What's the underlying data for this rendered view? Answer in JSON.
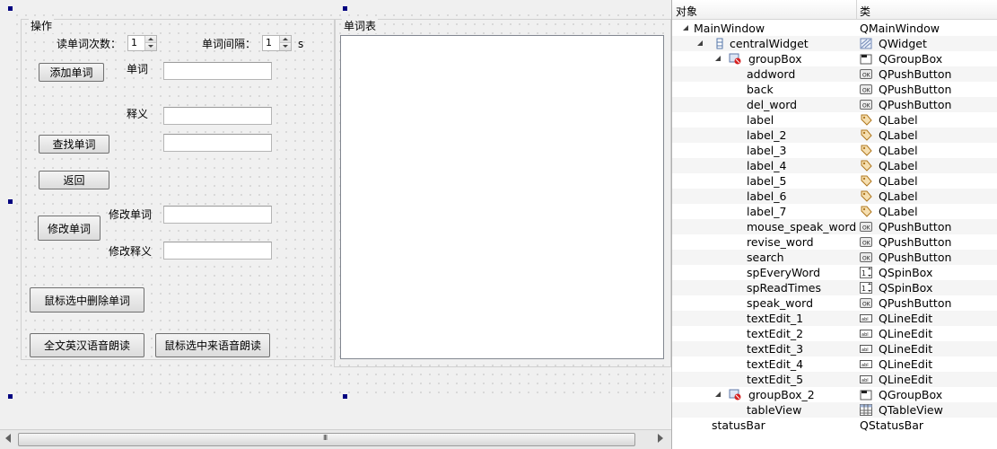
{
  "form": {
    "groupbox_ops_title": "操作",
    "groupbox_table_title": "单词表",
    "read_times_label": "读单词次数：",
    "read_times_value": "1",
    "interval_label": "单词间隔：",
    "interval_value": "1",
    "interval_unit": "s",
    "word_label": "单词",
    "meaning_label": "释义",
    "revise_word_label": "修改单词",
    "revise_meaning_label": "修改释义",
    "buttons": {
      "add_word": "添加单词",
      "search": "查找单词",
      "back": "返回",
      "revise": "修改单词",
      "delete_selected": "鼠标选中删除单词",
      "speak_all": "全文英汉语音朗读",
      "speak_selected": "鼠标选中来语音朗读"
    },
    "scrollbar_grip": "III"
  },
  "inspector": {
    "col_object": "对象",
    "col_class": "类",
    "rows": [
      {
        "object": "MainWindow",
        "class": "QMainWindow",
        "icon": "none",
        "class_icon": "none",
        "level": 0,
        "expander": true
      },
      {
        "object": "centralWidget",
        "class": "QWidget",
        "icon": "grid-layout-icon",
        "class_icon": "widget-icon",
        "level": 1,
        "expander": true
      },
      {
        "object": "groupBox",
        "class": "QGroupBox",
        "icon": "broken-layout-icon",
        "class_icon": "groupbox-icon",
        "level": 2,
        "expander": true
      },
      {
        "object": "addword",
        "class": "QPushButton",
        "icon": "none",
        "class_icon": "pushbutton-icon",
        "level": 3,
        "expander": false
      },
      {
        "object": "back",
        "class": "QPushButton",
        "icon": "none",
        "class_icon": "pushbutton-icon",
        "level": 3,
        "expander": false
      },
      {
        "object": "del_word",
        "class": "QPushButton",
        "icon": "none",
        "class_icon": "pushbutton-icon",
        "level": 3,
        "expander": false
      },
      {
        "object": "label",
        "class": "QLabel",
        "icon": "none",
        "class_icon": "label-icon",
        "level": 3,
        "expander": false
      },
      {
        "object": "label_2",
        "class": "QLabel",
        "icon": "none",
        "class_icon": "label-icon",
        "level": 3,
        "expander": false
      },
      {
        "object": "label_3",
        "class": "QLabel",
        "icon": "none",
        "class_icon": "label-icon",
        "level": 3,
        "expander": false
      },
      {
        "object": "label_4",
        "class": "QLabel",
        "icon": "none",
        "class_icon": "label-icon",
        "level": 3,
        "expander": false
      },
      {
        "object": "label_5",
        "class": "QLabel",
        "icon": "none",
        "class_icon": "label-icon",
        "level": 3,
        "expander": false
      },
      {
        "object": "label_6",
        "class": "QLabel",
        "icon": "none",
        "class_icon": "label-icon",
        "level": 3,
        "expander": false
      },
      {
        "object": "label_7",
        "class": "QLabel",
        "icon": "none",
        "class_icon": "label-icon",
        "level": 3,
        "expander": false
      },
      {
        "object": "mouse_speak_word",
        "class": "QPushButton",
        "icon": "none",
        "class_icon": "pushbutton-icon",
        "level": 3,
        "expander": false
      },
      {
        "object": "revise_word",
        "class": "QPushButton",
        "icon": "none",
        "class_icon": "pushbutton-icon",
        "level": 3,
        "expander": false
      },
      {
        "object": "search",
        "class": "QPushButton",
        "icon": "none",
        "class_icon": "pushbutton-icon",
        "level": 3,
        "expander": false
      },
      {
        "object": "spEveryWord",
        "class": "QSpinBox",
        "icon": "none",
        "class_icon": "spinbox-icon",
        "level": 3,
        "expander": false
      },
      {
        "object": "spReadTimes",
        "class": "QSpinBox",
        "icon": "none",
        "class_icon": "spinbox-icon",
        "level": 3,
        "expander": false
      },
      {
        "object": "speak_word",
        "class": "QPushButton",
        "icon": "none",
        "class_icon": "pushbutton-icon",
        "level": 3,
        "expander": false
      },
      {
        "object": "textEdit_1",
        "class": "QLineEdit",
        "icon": "none",
        "class_icon": "lineedit-icon",
        "level": 3,
        "expander": false
      },
      {
        "object": "textEdit_2",
        "class": "QLineEdit",
        "icon": "none",
        "class_icon": "lineedit-icon",
        "level": 3,
        "expander": false
      },
      {
        "object": "textEdit_3",
        "class": "QLineEdit",
        "icon": "none",
        "class_icon": "lineedit-icon",
        "level": 3,
        "expander": false
      },
      {
        "object": "textEdit_4",
        "class": "QLineEdit",
        "icon": "none",
        "class_icon": "lineedit-icon",
        "level": 3,
        "expander": false
      },
      {
        "object": "textEdit_5",
        "class": "QLineEdit",
        "icon": "none",
        "class_icon": "lineedit-icon",
        "level": 3,
        "expander": false
      },
      {
        "object": "groupBox_2",
        "class": "QGroupBox",
        "icon": "broken-layout-icon",
        "class_icon": "groupbox-icon",
        "level": 2,
        "expander": true
      },
      {
        "object": "tableView",
        "class": "QTableView",
        "icon": "none",
        "class_icon": "tableview-icon",
        "level": 3,
        "expander": false
      },
      {
        "object": "statusBar",
        "class": "QStatusBar",
        "icon": "none",
        "class_icon": "none",
        "level": 1,
        "expander": false
      }
    ]
  }
}
